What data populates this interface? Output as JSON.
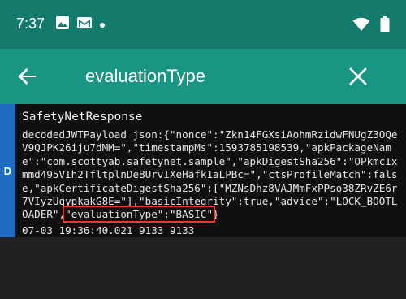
{
  "status_bar": {
    "time": "7:37",
    "left_icons": [
      "image-icon",
      "gmail-icon",
      "dot-icon"
    ],
    "right_icons": [
      "wifi-icon",
      "battery-icon"
    ]
  },
  "app_bar": {
    "back_icon": "arrow-left-icon",
    "search_value": "evaluationType",
    "clear_icon": "close-icon"
  },
  "log_entry": {
    "level": "D",
    "tag": "SafetyNetResponse",
    "message_before": "decodedJWTPayload json:{\"nonce\":\"Zkn14FGXsiAohmRzidwFNUgZ3OQeV9QJPK26iju7dMM=\",\"timestampMs\":1593785198539,\"apkPackageName\":\"com.scottyab.safetynet.sample\",\"apkDigestSha256\":\"OPkmcIxmmd495VIh2TfltplnDeBUrvIXeHafk1aLPBc=\",\"ctsProfileMatch\":false,\"apkCertificateDigestSha256\":[\"MZNsDhz8VAJMmFxPPso38ZRvZE6r7VIyzUqypkakG8E=\"],\"basicIntegrity\":true,\"advice\":\"LOCK_BOOTLOADER\",",
    "message_highlight": "\"evaluationType\":\"BASIC\"",
    "message_after": "}",
    "meta": "07-03 19:36:40.021 9133 9133"
  },
  "colors": {
    "status_bar": "#147a6c",
    "app_bar": "#1a9483",
    "level_debug": "#1e6bc4",
    "highlight_box": "#e53935",
    "background": "#212121"
  }
}
